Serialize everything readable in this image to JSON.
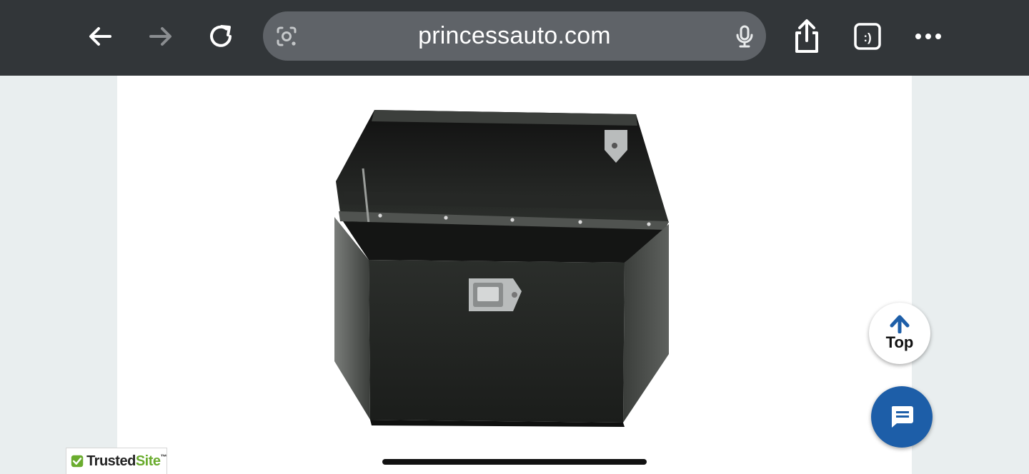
{
  "browser": {
    "url": "princessauto.com",
    "icons": {
      "back": "back-arrow-icon",
      "forward": "forward-arrow-icon",
      "reload": "reload-icon",
      "lens": "google-lens-icon",
      "mic": "microphone-icon",
      "share": "share-icon",
      "tab_switcher": "tab-switcher-icon",
      "menu": "more-menu-icon"
    },
    "colors": {
      "toolbar": "#323639",
      "urlbar": "#5f6368"
    }
  },
  "page": {
    "product_image": "black-hexagonal-trailer-tongue-toolbox-open-lid",
    "top_button_label": "Top",
    "chat_icon": "chat-bubble-icon",
    "trusted_badge": {
      "part1": "Trusted",
      "part2": "Site",
      "mark": "™"
    },
    "colors": {
      "chat": "#1d5ea8",
      "arrow": "#1d5ea8",
      "trusted_green": "#6aac2e"
    }
  }
}
